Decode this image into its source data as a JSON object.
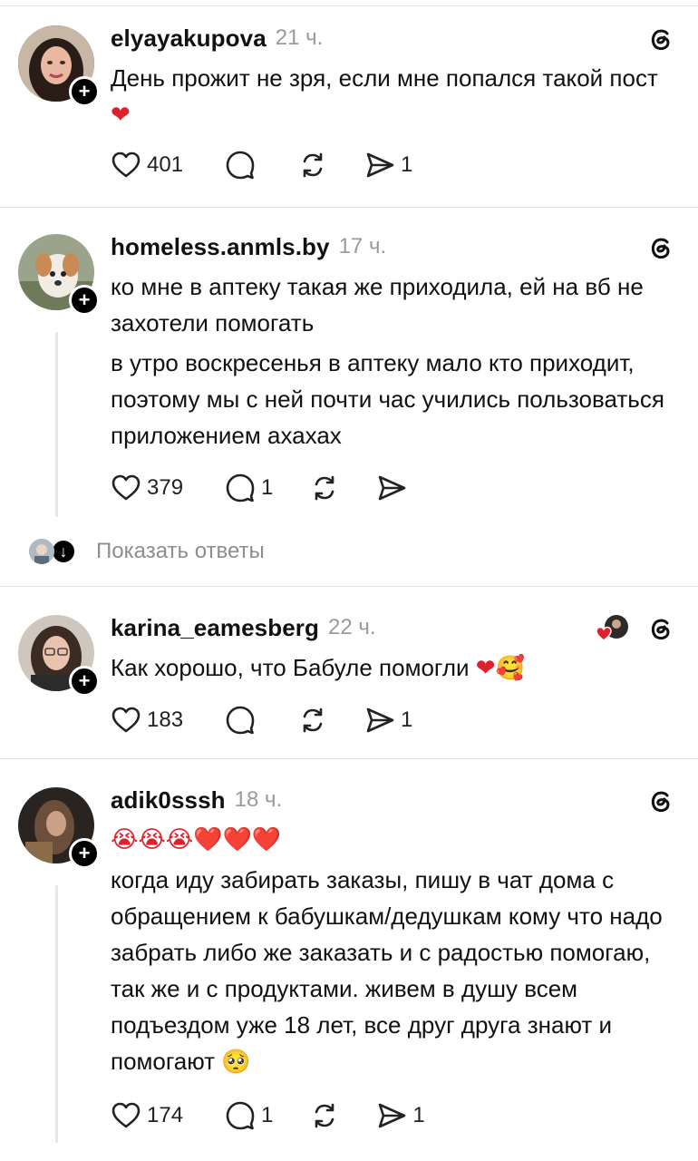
{
  "posts": [
    {
      "username": "elyayakupova",
      "time": "21 ч.",
      "lines": [
        "День прожит не зря, если мне попался такой пост"
      ],
      "likes": "401",
      "comments": "",
      "shares": "1"
    },
    {
      "username": "homeless.anmls.by",
      "time": "17 ч.",
      "lines": [
        "ко мне в аптеку такая же приходила, ей на вб не захотели помогать",
        "в утро воскресенья в аптеку мало кто приходит, поэтому мы с ней почти час учились пользоваться приложением ахахах"
      ],
      "likes": "379",
      "comments": "1",
      "shares": ""
    },
    {
      "username": "karina_eamesberg",
      "time": "22 ч.",
      "lines": [
        "Как хорошо, что Бабуле помогли"
      ],
      "likes": "183",
      "comments": "",
      "shares": "1"
    },
    {
      "username": "adik0sssh",
      "time": "18 ч.",
      "lines": [
        "😭😭😭❤️❤️❤️",
        "когда иду забирать заказы, пишу в чат дома с обращением к бабушкам/дедушкам кому что надо забрать либо же заказать и с радостью помогаю, так же и с продуктами. живем в душу всем подъездом уже 18 лет, все друг друга знают и помогают"
      ],
      "likes": "174",
      "comments": "1",
      "shares": "1"
    }
  ],
  "show_replies_label": "Показать ответы",
  "icons": {
    "follow": "plus-icon",
    "like": "heart-icon",
    "comment": "comment-icon",
    "repost": "repost-icon",
    "share": "send-icon",
    "platform": "threads-logo-icon"
  },
  "colors": {
    "heart": "#e0202a",
    "muted": "#9a9a9a",
    "divider": "#e3e3e3"
  }
}
